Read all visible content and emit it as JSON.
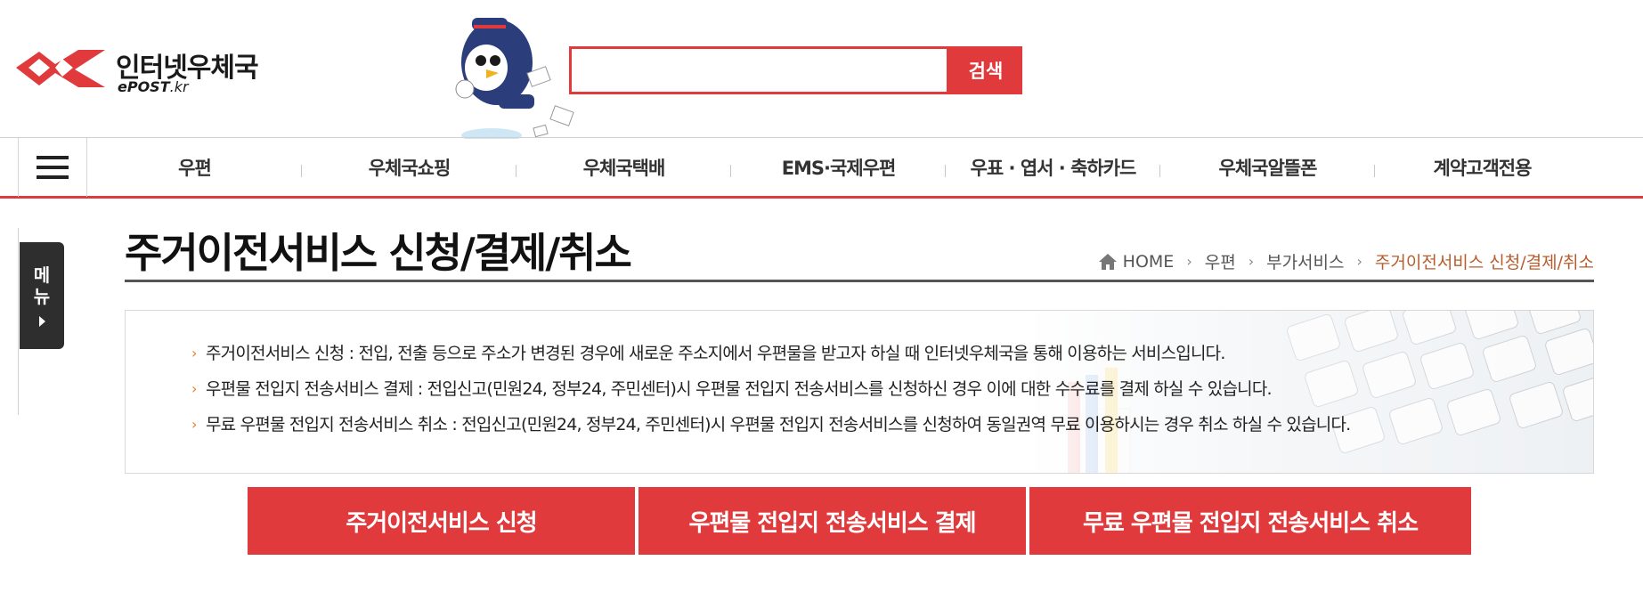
{
  "header": {
    "logo_title": "인터넷우체국",
    "logo_sub_bold": "ePOST",
    "logo_sub_thin": ".kr",
    "search_placeholder": "",
    "search_button": "검색"
  },
  "nav": {
    "items": [
      {
        "label": "우편"
      },
      {
        "label": "우체국쇼핑"
      },
      {
        "label": "우체국택배"
      },
      {
        "label": "EMS·국제우편"
      },
      {
        "label": "우표 · 엽서 · 축하카드"
      },
      {
        "label": "우체국알뜰폰"
      },
      {
        "label": "계약고객전용"
      }
    ]
  },
  "side_menu": {
    "label": "메뉴"
  },
  "page": {
    "title": "주거이전서비스 신청/결제/취소",
    "breadcrumb": {
      "home": "HOME",
      "level1": "우편",
      "level2": "부가서비스",
      "current": "주거이전서비스 신청/결제/취소"
    }
  },
  "info": {
    "items": [
      "주거이전서비스 신청 : 전입, 전출 등으로 주소가 변경된 경우에 새로운 주소지에서 우편물을 받고자 하실 때 인터넷우체국을 통해 이용하는 서비스입니다.",
      "우편물 전입지 전송서비스 결제 : 전입신고(민원24, 정부24, 주민센터)시 우편물 전입지 전송서비스를 신청하신 경우 이에 대한 수수료를 결제 하실 수 있습니다.",
      "무료 우편물 전입지 전송서비스 취소 : 전입신고(민원24, 정부24, 주민센터)시 우편물 전입지 전송서비스를 신청하여 동일권역 무료 이용하시는 경우 취소 하실 수 있습니다."
    ]
  },
  "actions": {
    "apply": "주거이전서비스 신청",
    "pay": "우편물 전입지 전송서비스 결제",
    "cancel": "무료 우편물 전입지 전송서비스 취소"
  },
  "colors": {
    "accent": "#e03a3c",
    "breadcrumb_current": "#b85c2e",
    "bullet": "#e67e22"
  }
}
